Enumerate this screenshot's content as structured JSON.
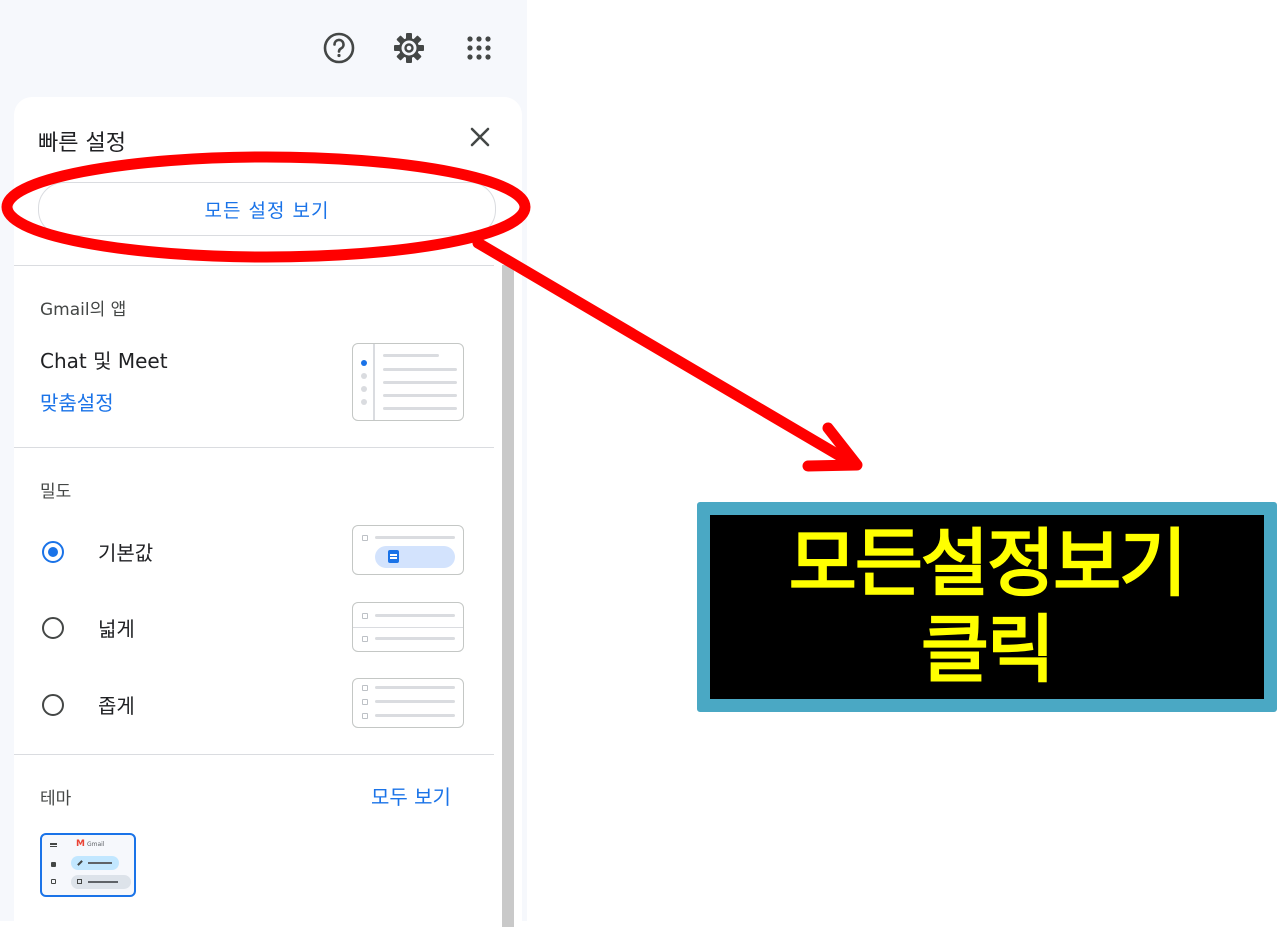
{
  "quick_settings": {
    "title": "빠른 설정",
    "all_settings_label": "모든 설정 보기"
  },
  "apps_section": {
    "label": "Gmail의 앱",
    "item_label": "Chat 및 Meet",
    "customize_link": "맞춤설정"
  },
  "density_section": {
    "label": "밀도",
    "options": [
      {
        "label": "기본값",
        "selected": true
      },
      {
        "label": "넓게",
        "selected": false
      },
      {
        "label": "좁게",
        "selected": false
      }
    ]
  },
  "theme_section": {
    "label": "테마",
    "view_all_link": "모두 보기",
    "thumb_text": "Gmail"
  },
  "annotation": {
    "line1": "모든설정보기",
    "line2": "클릭",
    "highlight_color": "#ff0000",
    "text_color": "#ffff00",
    "border_color": "#4aa8c4"
  },
  "colors": {
    "accent": "#1a73e8",
    "background": "#f6f8fc"
  }
}
